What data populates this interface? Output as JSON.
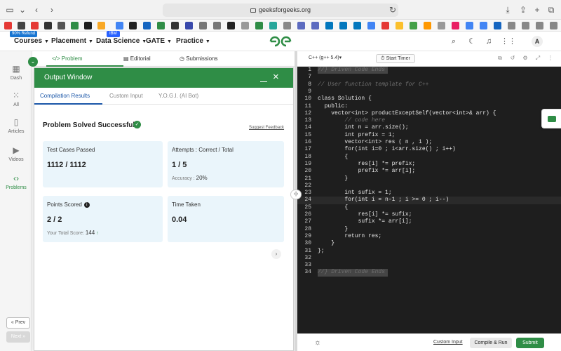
{
  "browser": {
    "url": "geeksforgeeks.org",
    "refund_badge": "90% Refund",
    "ibm_badge": "IBM"
  },
  "nav": {
    "items": [
      "Courses",
      "Placement",
      "Data Science",
      "GATE",
      "Practice"
    ],
    "avatar_letter": "A"
  },
  "rail": {
    "items": [
      {
        "label": "Dash",
        "icon": "dashboard-icon"
      },
      {
        "label": "All",
        "icon": "grid-icon"
      },
      {
        "label": "Articles",
        "icon": "book-icon"
      },
      {
        "label": "Videos",
        "icon": "video-icon"
      },
      {
        "label": "Problems",
        "icon": "code-icon"
      }
    ],
    "prev_label": "« Prev",
    "next_label": "Next »"
  },
  "problem_tabs": {
    "problem": "</> Problem",
    "editorial": "Editorial",
    "submissions": "Submissions"
  },
  "output_window": {
    "title": "Output Window",
    "tabs": [
      "Compilation Results",
      "Custom Input",
      "Y.O.G.I. (AI Bot)"
    ],
    "status": "Problem Solved Successfully",
    "feedback_link": "Suggest Feedback",
    "cards": {
      "test_cases": {
        "label": "Test Cases Passed",
        "value": "1112 / 1112"
      },
      "attempts": {
        "label": "Attempts : Correct / Total",
        "value": "1 / 5",
        "sub_label": "Accuracy :",
        "sub_value": "20%"
      },
      "points": {
        "label": "Points Scored",
        "value": "2 / 2",
        "sub_label": "Your Total Score:",
        "sub_value": "144"
      },
      "time": {
        "label": "Time Taken",
        "value": "0.04"
      }
    }
  },
  "editor": {
    "language": "C++ (g++ 5.4)▾",
    "timer_label": "Start Timer",
    "lines": [
      {
        "n": "1",
        "t": "//} Driven Code Ends",
        "cls": "fold comment"
      },
      {
        "n": "7",
        "t": "",
        "cls": ""
      },
      {
        "n": "8",
        "t": "// User function template for C++",
        "cls": "comment"
      },
      {
        "n": "9",
        "t": "",
        "cls": ""
      },
      {
        "n": "10",
        "t": "class Solution {",
        "cls": ""
      },
      {
        "n": "11",
        "t": "  public:",
        "cls": ""
      },
      {
        "n": "12",
        "t": "    vector<int> productExceptSelf(vector<int>& arr) {",
        "cls": ""
      },
      {
        "n": "13",
        "t": "        // code here",
        "cls": "comment"
      },
      {
        "n": "14",
        "t": "        int n = arr.size();",
        "cls": ""
      },
      {
        "n": "15",
        "t": "        int prefix = 1;",
        "cls": ""
      },
      {
        "n": "16",
        "t": "        vector<int> res ( n , 1 );",
        "cls": ""
      },
      {
        "n": "17",
        "t": "        for(int i=0 ; i<arr.size() ; i++)",
        "cls": ""
      },
      {
        "n": "18",
        "t": "        {",
        "cls": ""
      },
      {
        "n": "19",
        "t": "            res[i] *= prefix;",
        "cls": ""
      },
      {
        "n": "20",
        "t": "            prefix *= arr[i];",
        "cls": ""
      },
      {
        "n": "21",
        "t": "        }",
        "cls": ""
      },
      {
        "n": "22",
        "t": "",
        "cls": ""
      },
      {
        "n": "23",
        "t": "        int sufix = 1;",
        "cls": ""
      },
      {
        "n": "24",
        "t": "        for(int i = n-1 ; i >= 0 ; i--)",
        "cls": "hl"
      },
      {
        "n": "25",
        "t": "        {",
        "cls": ""
      },
      {
        "n": "26",
        "t": "            res[i] *= sufix;",
        "cls": ""
      },
      {
        "n": "27",
        "t": "            sufix *= arr[i];",
        "cls": ""
      },
      {
        "n": "28",
        "t": "        }",
        "cls": ""
      },
      {
        "n": "29",
        "t": "        return res;",
        "cls": ""
      },
      {
        "n": "30",
        "t": "    }",
        "cls": ""
      },
      {
        "n": "31",
        "t": "};",
        "cls": ""
      },
      {
        "n": "32",
        "t": "",
        "cls": ""
      },
      {
        "n": "33",
        "t": "",
        "cls": ""
      },
      {
        "n": "34",
        "t": "//} Driven Code Ends",
        "cls": "fold comment"
      }
    ],
    "custom_input_label": "Custom Input",
    "compile_label": "Compile & Run",
    "submit_label": "Submit"
  },
  "colors": {
    "brand_green": "#2f8d46",
    "tab_blue": "#1a56a8",
    "card_bg": "#eaf5fb",
    "editor_bg": "#1e1e1e"
  }
}
